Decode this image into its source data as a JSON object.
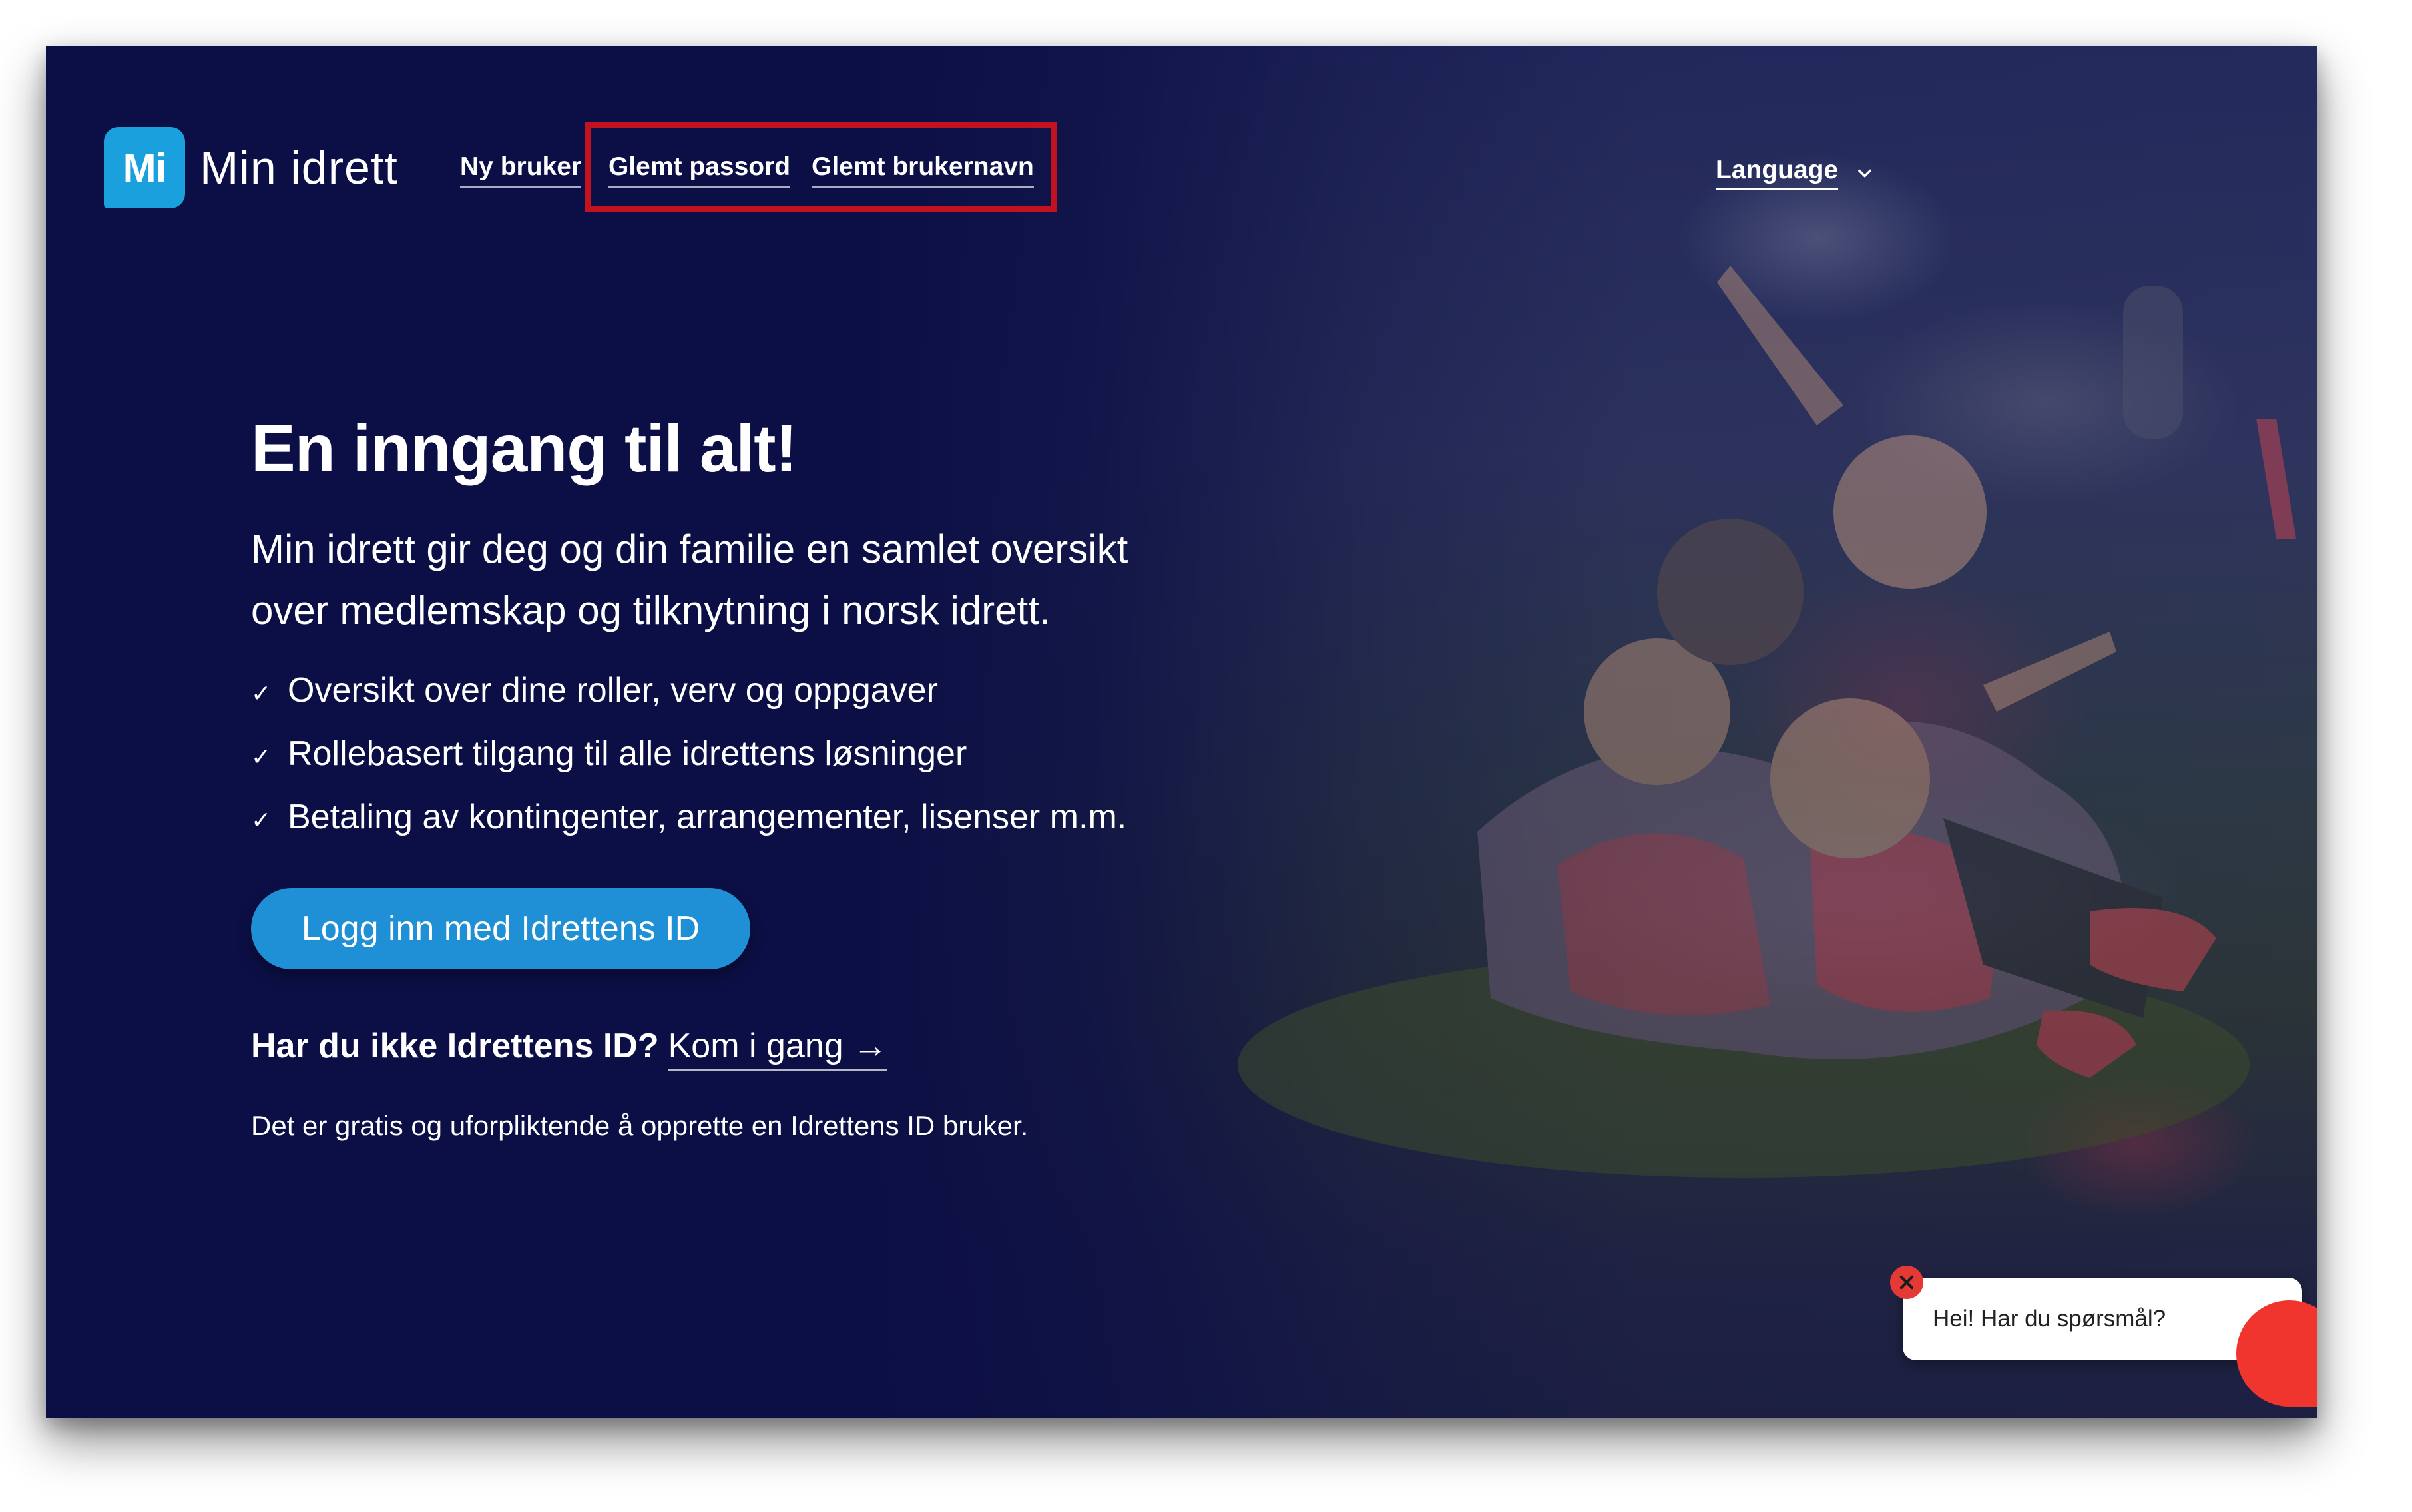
{
  "header": {
    "logo_badge": "Mi",
    "logo_text": "Min idrett",
    "nav": {
      "new_user": "Ny bruker",
      "forgot_password": "Glemt passord",
      "forgot_username": "Glemt brukernavn"
    },
    "language_label": "Language"
  },
  "hero": {
    "title": "En inngang til alt!",
    "subtitle_line1": "Min idrett gir deg og din familie en samlet oversikt",
    "subtitle_line2": "over medlemskap og tilknytning i norsk idrett.",
    "checklist": [
      "Oversikt over dine roller, verv og oppgaver",
      "Rollebasert tilgang til alle idrettens løsninger",
      "Betaling av kontingenter, arrangementer, lisenser m.m."
    ],
    "check_glyph": "✓",
    "login_button": "Logg inn med Idrettens ID",
    "no_id_question": "Har du ikke Idrettens ID?",
    "get_started_link": "Kom i gang →",
    "free_note": "Det er gratis og uforpliktende å opprette en Idrettens ID bruker."
  },
  "chat": {
    "greeting": "Hei! Har du spørsmål?"
  },
  "colors": {
    "background": "#0c0f45",
    "brand_blue": "#1aa0dc",
    "button_blue": "#1f8fd6",
    "highlight_red": "#c1121f",
    "chat_red": "#f0352f"
  },
  "icons": {
    "language_chevron": "chevron-down-icon",
    "chat_close": "close-icon",
    "chat_launcher": "chat-bubble-icon"
  }
}
